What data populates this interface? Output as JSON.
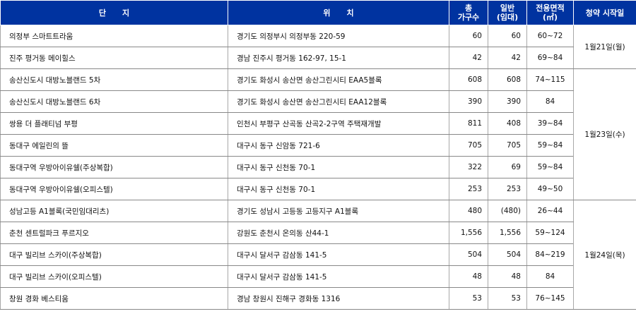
{
  "header": {
    "complex": "단      지",
    "location": "위      치",
    "total_households_1": "총",
    "total_households_2": "가구수",
    "general_1": "일반",
    "general_2": "(임대)",
    "area_1": "전용면적",
    "area_2": "(㎡)",
    "start_date": "청약 시작일"
  },
  "rows": [
    {
      "name": "의정부 스마트트라움",
      "location": "경기도 의정부시 의정부동 220-59",
      "total": "60",
      "general": "60",
      "area": "60~72"
    },
    {
      "name": "진주 평거동 메이힐스",
      "location": "경남 진주시 평거동 162-97, 15-1",
      "total": "42",
      "general": "42",
      "area": "69~84"
    },
    {
      "name": "송산신도시 대방노블랜드 5차",
      "location": "경기도 화성시 송산면 송산그린시티 EAA5블록",
      "total": "608",
      "general": "608",
      "area": "74~115"
    },
    {
      "name": "송산신도시 대방노블랜드 6차",
      "location": "경기도 화성시 송산면 송산그린시티 EAA12블록",
      "total": "390",
      "general": "390",
      "area": "84"
    },
    {
      "name": "쌍용 더 플래티넘 부평",
      "location": "인천시 부평구 산곡동 산곡2-2구역 주택재개발",
      "total": "811",
      "general": "408",
      "area": "39~84"
    },
    {
      "name": "동대구 에일린의 뜰",
      "location": "대구시 동구 신암동 721-6",
      "total": "705",
      "general": "705",
      "area": "59~84"
    },
    {
      "name": "동대구역 우방아이유쉘(주상복합)",
      "location": "대구시 동구 신천동 70-1",
      "total": "322",
      "general": "69",
      "area": "59~84"
    },
    {
      "name": "동대구역 우방아이유쉘(오피스텔)",
      "location": "대구시 동구 신천동 70-1",
      "total": "253",
      "general": "253",
      "area": "49~50"
    },
    {
      "name": "성남고등 A1블록(국민임대리츠)",
      "location": "경기도 성남시 고등동 고등지구 A1블록",
      "total": "480",
      "general": "(480)",
      "area": "26~44"
    },
    {
      "name": "춘천 센트럴파크 푸르지오",
      "location": "강원도 춘천시 온의동 산44-1",
      "total": "1,556",
      "general": "1,556",
      "area": "59~124"
    },
    {
      "name": "대구 빌리브 스카이(주상복합)",
      "location": "대구시 달서구 감삼동 141-5",
      "total": "504",
      "general": "504",
      "area": "84~219"
    },
    {
      "name": "대구 빌리브 스카이(오피스텔)",
      "location": "대구시 달서구 감삼동 141-5",
      "total": "48",
      "general": "48",
      "area": "84"
    },
    {
      "name": "창원 경화 베스티움",
      "location": "경남 창원시 진해구 경화동 1316",
      "total": "53",
      "general": "53",
      "area": "76~145"
    }
  ],
  "dates": [
    "",
    "1월21일(월)",
    "1월23일(수)",
    "1월24일(목)"
  ]
}
